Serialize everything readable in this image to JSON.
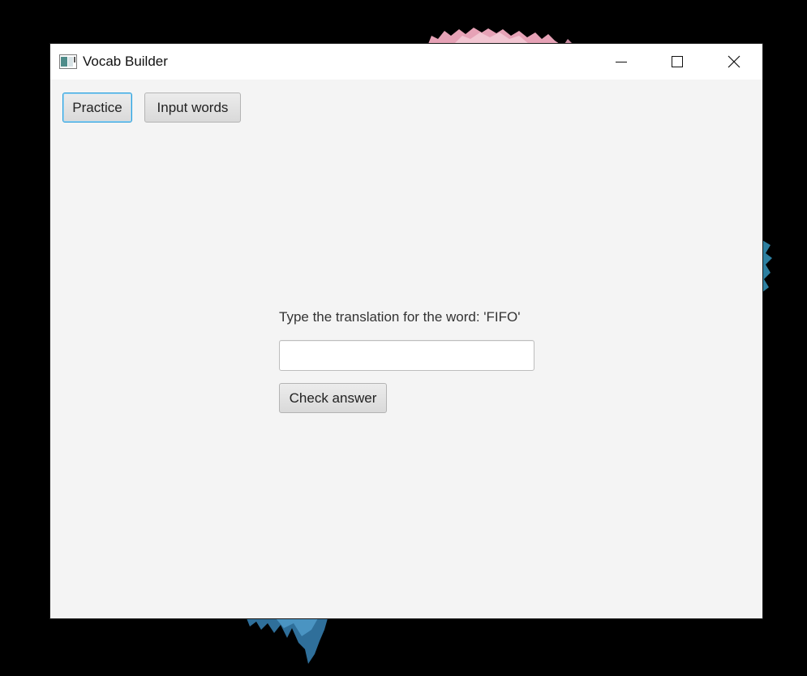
{
  "window": {
    "title": "Vocab Builder",
    "app_icon": "app-window-icon",
    "controls": {
      "minimize_icon": "minimize-icon",
      "maximize_icon": "maximize-icon",
      "close_icon": "close-icon"
    }
  },
  "toolbar": {
    "practice_label": "Practice",
    "input_words_label": "Input words"
  },
  "practice": {
    "prompt": "Type the translation for the word: 'FIFO'",
    "answer_value": "",
    "answer_placeholder": "",
    "check_label": "Check answer"
  },
  "colors": {
    "window_bg": "#f4f4f4",
    "titlebar_bg": "#ffffff",
    "focus_accent": "#2a9fdc",
    "desktop_bg": "#000000"
  }
}
